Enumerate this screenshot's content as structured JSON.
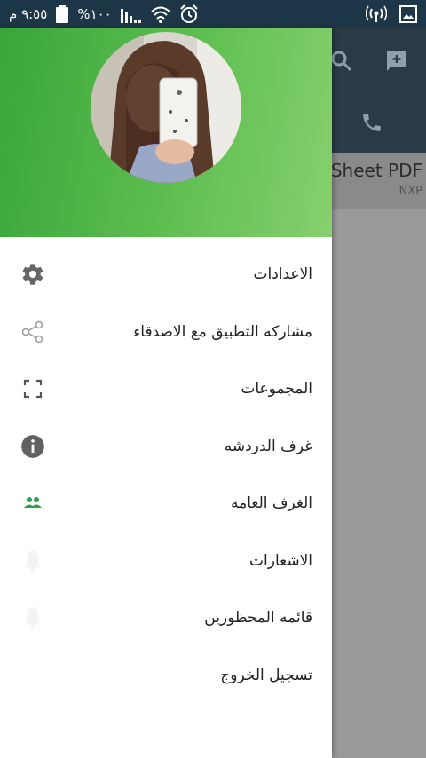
{
  "status_bar": {
    "time": "٩:٥٥ م",
    "battery": "%١٠٠"
  },
  "background": {
    "row_title": "Sheet PDF",
    "row_subtitle": "NXP"
  },
  "drawer": {
    "menu_items": [
      {
        "label": "الاعدادات",
        "icon": "gear-icon"
      },
      {
        "label": "مشاركه التطبيق مع الاصدقاء",
        "icon": "share-icon"
      },
      {
        "label": "المجموعات",
        "icon": "fullscreen-icon"
      },
      {
        "label": "غرف الدردشه",
        "icon": "info-icon"
      },
      {
        "label": "الغرف العامه",
        "icon": "people-icon"
      },
      {
        "label": "الاشعارات",
        "icon": "bell-icon"
      },
      {
        "label": "قائمه المحظورين",
        "icon": "bell-icon"
      },
      {
        "label": "تسجيل الخروج",
        "icon": ""
      }
    ]
  },
  "colors": {
    "header_green": "#4caf50",
    "status_bar": "#1e3748",
    "accent_green": "#2e9e4f"
  }
}
